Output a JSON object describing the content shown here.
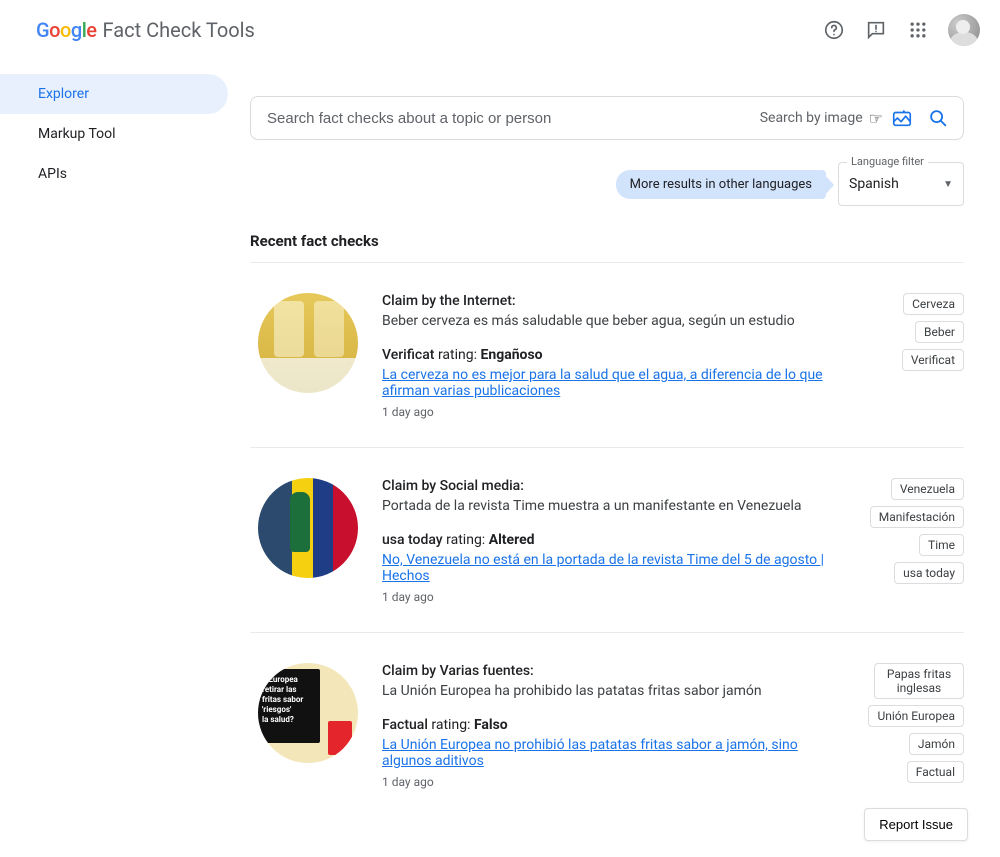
{
  "header": {
    "title": "Fact Check Tools"
  },
  "sidebar": {
    "items": [
      {
        "label": "Explorer",
        "active": true
      },
      {
        "label": "Markup Tool",
        "active": false
      },
      {
        "label": "APIs",
        "active": false
      }
    ]
  },
  "search": {
    "placeholder": "Search fact checks about a topic or person",
    "by_image_label": "Search by image"
  },
  "filter": {
    "more_languages_hint": "More results in other languages",
    "language_filter_label": "Language filter",
    "language_value": "Spanish"
  },
  "section_title": "Recent fact checks",
  "report_issue_label": "Report Issue",
  "cards": [
    {
      "claim_by_prefix": "Claim by ",
      "claim_by": "the Internet",
      "claim_text": "Beber cerveza es más saludable que beber agua, según un estudio",
      "source": "Verificat",
      "rating_word": "rating:",
      "rating": "Engañoso",
      "article": "La cerveza no es mejor para la salud que el agua, a diferencia de lo que afirman varias publicaciones",
      "time_ago": "1 day ago",
      "tags": [
        "Cerveza",
        "Beber",
        "Verificat"
      ]
    },
    {
      "claim_by_prefix": "Claim by ",
      "claim_by": "Social media",
      "claim_text": "Portada de la revista Time muestra a un manifestante en Venezuela",
      "source": "usa today",
      "rating_word": "rating:",
      "rating": "Altered",
      "article": "No, Venezuela no está en la portada de la revista Time del 5 de agosto | Hechos",
      "time_ago": "1 day ago",
      "tags": [
        "Venezuela",
        "Manifestación",
        "Time",
        "usa today"
      ]
    },
    {
      "claim_by_prefix": "Claim by ",
      "claim_by": "Varias fuentes",
      "claim_text": "La Unión Europea ha prohibido las patatas fritas sabor jamón",
      "source": "Factual",
      "rating_word": "rating:",
      "rating": "Falso",
      "article": "La Unión Europea no prohibió las patatas fritas sabor a jamón, sino algunos aditivos",
      "time_ago": "1 day ago",
      "tags": [
        "Papas fritas inglesas",
        "Unión Europea",
        "Jamón",
        "Factual"
      ]
    }
  ]
}
